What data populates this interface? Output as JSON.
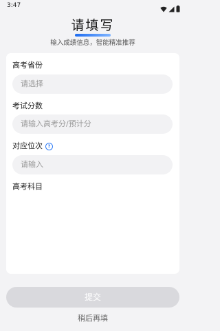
{
  "status_bar": {
    "time": "3:47"
  },
  "header": {
    "title": "请填写",
    "subtitle": "输入成绩信息，智能精准推荐"
  },
  "form": {
    "province": {
      "label": "高考省份",
      "placeholder": "请选择"
    },
    "score": {
      "label": "考试分数",
      "placeholder": "请输入高考分/预计分"
    },
    "rank": {
      "label": "对应位次",
      "placeholder": "请输入"
    },
    "subjects": {
      "label": "高考科目"
    }
  },
  "actions": {
    "submit_label": "提交",
    "later_label": "稍后再填"
  },
  "colors": {
    "accent": "#2f7cf6",
    "page_bg": "#f3f3f5",
    "card_bg": "#ffffff",
    "input_bg": "#f2f2f4",
    "submit_disabled": "#d9d9dd"
  }
}
